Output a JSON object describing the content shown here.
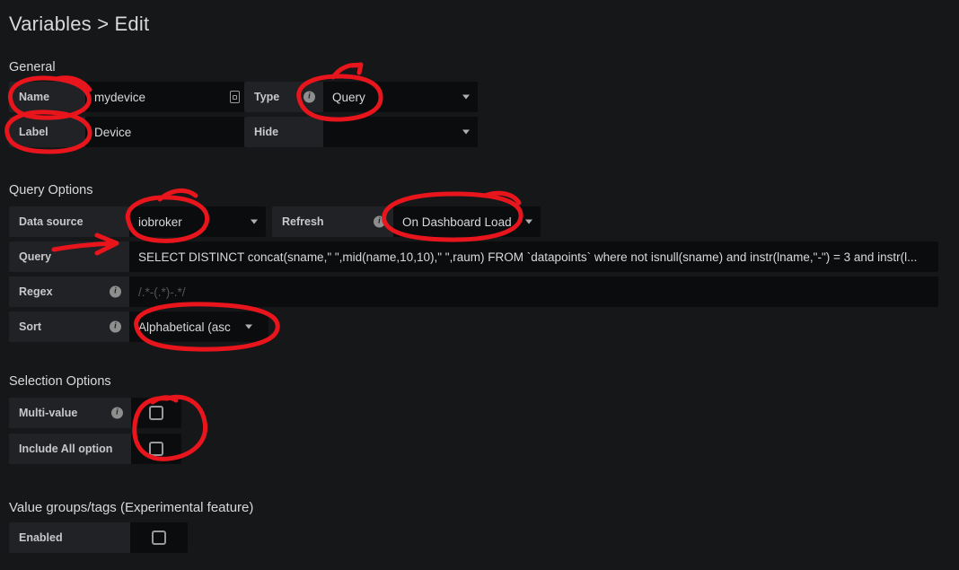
{
  "page": {
    "title": "Variables > Edit",
    "bg_color": "#161719",
    "annotation_color": "#e8151c"
  },
  "sections": {
    "general": {
      "heading": "General",
      "name": {
        "label": "Name",
        "value": "mydevice",
        "badge_icon": "text-input-badge-icon"
      },
      "label": {
        "label": "Label",
        "value": "Device"
      },
      "type": {
        "label": "Type",
        "info_icon": "info-icon",
        "value": "Query",
        "caret_icon": "chevron-down-icon"
      },
      "hide": {
        "label": "Hide",
        "value": "",
        "caret_icon": "chevron-down-icon"
      }
    },
    "query_options": {
      "heading": "Query Options",
      "data_source": {
        "label": "Data source",
        "value": "iobroker",
        "caret_icon": "chevron-down-icon"
      },
      "refresh": {
        "label": "Refresh",
        "info_icon": "info-icon",
        "value": "On Dashboard Load",
        "caret_icon": "chevron-down-icon"
      },
      "query": {
        "label": "Query",
        "value": "SELECT DISTINCT concat(sname,\" \",mid(name,10,10),\" \",raum) FROM `datapoints` where not isnull(sname) and instr(lname,\"-\") = 3 and instr(l..."
      },
      "regex": {
        "label": "Regex",
        "info_icon": "info-icon",
        "placeholder": "/.*-(.*)-.*/",
        "value": ""
      },
      "sort": {
        "label": "Sort",
        "info_icon": "info-icon",
        "value": "Alphabetical (asc",
        "caret_icon": "chevron-down-icon"
      }
    },
    "selection_options": {
      "heading": "Selection Options",
      "multi_value": {
        "label": "Multi-value",
        "info_icon": "info-icon",
        "checked": false
      },
      "include_all": {
        "label": "Include All option",
        "checked": false
      }
    },
    "value_groups": {
      "heading": "Value groups/tags (Experimental feature)",
      "enabled": {
        "label": "Enabled",
        "checked": false
      }
    }
  }
}
